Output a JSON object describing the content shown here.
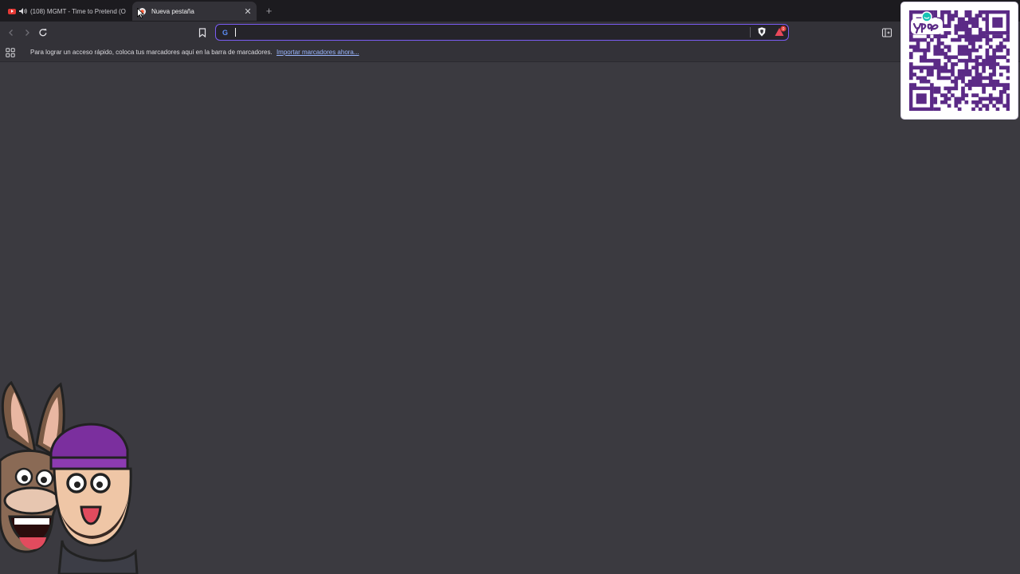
{
  "tabs": [
    {
      "title": "(108) MGMT - Time to Pretend (O",
      "icon": "youtube-icon",
      "audio": "speaker-icon",
      "active": false
    },
    {
      "title": "Nueva pestaña",
      "icon": "brave-favicon-icon",
      "active": true
    }
  ],
  "toolbar": {
    "omnibox": {
      "value": "",
      "placeholder": ""
    },
    "search_engine_icon": "google-icon",
    "accent": "#7a5cf4"
  },
  "bookmarks_bar": {
    "message": "Para lograr un acceso rápido, coloca tus marcadores aquí en la barra de marcadores.",
    "import_link": "Importar marcadores ahora..."
  },
  "overlays": {
    "qr_brand": "yape",
    "qr_color": "#5b2a86"
  },
  "colors": {
    "page_background": "#3b3a40",
    "tab_strip": "#1c1b1f",
    "toolbar": "#333238"
  }
}
